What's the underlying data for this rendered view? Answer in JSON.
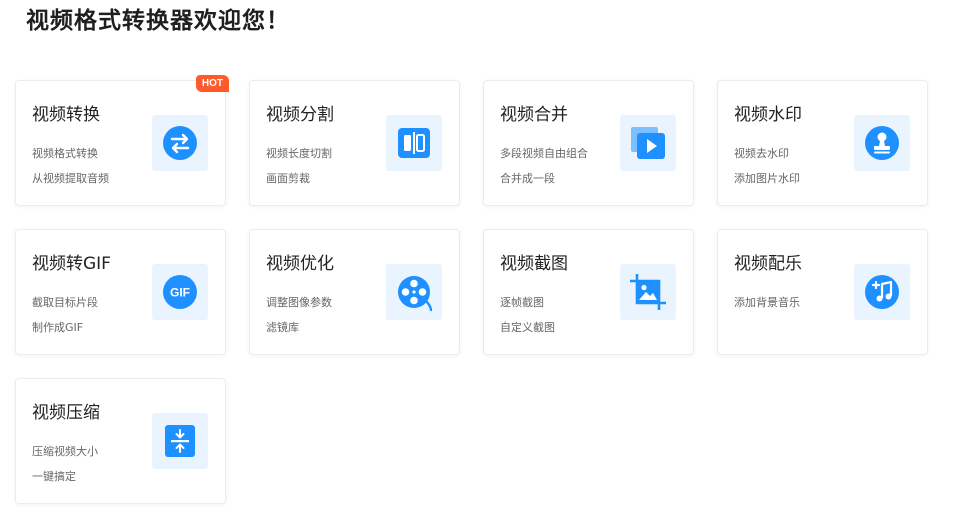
{
  "page": {
    "title": "视频格式转换器欢迎您！"
  },
  "colors": {
    "accent": "#1e90ff",
    "icon_tile_bg": "#eaf4ff",
    "hot_badge": "#ff5a2c"
  },
  "cards": [
    {
      "title": "视频转换",
      "desc1": "视频格式转换",
      "desc2": "从视频提取音频",
      "icon": "swap-arrows-icon",
      "badge": "HOT"
    },
    {
      "title": "视频分割",
      "desc1": "视频长度切割",
      "desc2": "画面剪裁",
      "icon": "split-icon"
    },
    {
      "title": "视频合并",
      "desc1": "多段视频自由组合",
      "desc2": "合并成一段",
      "icon": "video-merge-icon"
    },
    {
      "title": "视频水印",
      "desc1": "视频去水印",
      "desc2": "添加图片水印",
      "icon": "watermark-stamp-icon"
    },
    {
      "title": "视频转GIF",
      "desc1": "截取目标片段",
      "desc2": "制作成GIF",
      "icon": "gif-icon",
      "icon_text": "GIF"
    },
    {
      "title": "视频优化",
      "desc1": "调整图像参数",
      "desc2": "滤镜库",
      "icon": "film-reel-icon"
    },
    {
      "title": "视频截图",
      "desc1": "逐帧截图",
      "desc2": "自定义截图",
      "icon": "screenshot-crop-icon"
    },
    {
      "title": "视频配乐",
      "desc1": "添加背景音乐",
      "desc2": "",
      "icon": "music-add-icon"
    },
    {
      "title": "视频压缩",
      "desc1": "压缩视频大小",
      "desc2": "一键搞定",
      "icon": "compress-icon"
    }
  ]
}
